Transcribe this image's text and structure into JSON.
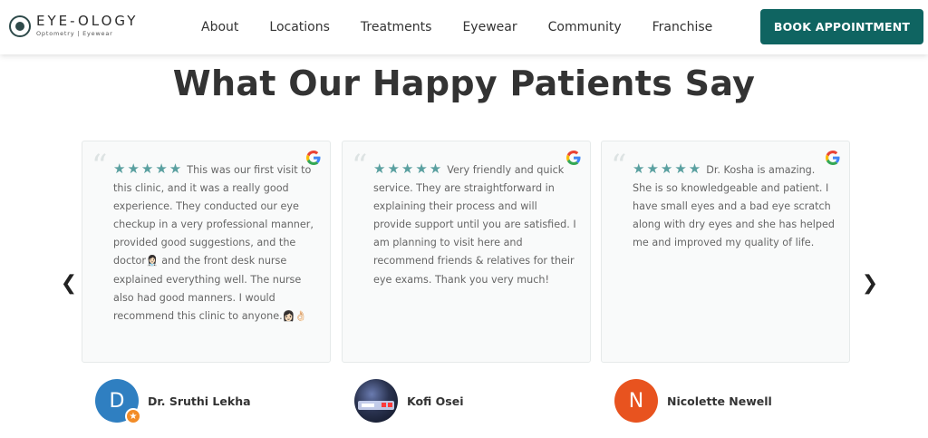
{
  "header": {
    "logo_name": "EYE-OLOGY",
    "logo_sub": "Optometry | Eyewear",
    "nav": [
      "About",
      "Locations",
      "Treatments",
      "Eyewear",
      "Community",
      "Franchise"
    ],
    "cta": "BOOK APPOINTMENT"
  },
  "section": {
    "heading_light": "What Our ",
    "heading_bold": "Happy Patients Say"
  },
  "carousel": {
    "prev": "❮",
    "next": "❯",
    "stars": "★★★★★",
    "reviews": [
      {
        "text_1": "This was our first visit to this clinic, and it was a really good experience. They conducted our eye checkup in a very professional manner, provided good suggestions, and the doctor",
        "text_2": " and the front desk nurse explained everything well. The nurse also had good manners. I would recommend this clinic to anyone.",
        "author": "Dr. Sruthi Lekha",
        "avatar_letter": "D",
        "avatar_color": "#2f7fc1"
      },
      {
        "text_1": "Very friendly and quick service. They are straightforward in explaining their process and will provide support until you are satisfied. I am planning to visit here and recommend friends & relatives for their eye exams. Thank you very much!",
        "author": "Kofi Osei",
        "avatar_letter": "",
        "avatar_color": "#1c2433"
      },
      {
        "text_1": "Dr. Kosha is amazing. She is so knowledgeable and patient. I have small eyes and a bad eye scratch along with dry eyes and she has helped me and improved my quality of life.",
        "author": "Nicolette Newell",
        "avatar_letter": "N",
        "avatar_color": "#e8531f"
      }
    ]
  },
  "colors": {
    "brand": "#0f6461",
    "stars": "#5aa0a0"
  }
}
